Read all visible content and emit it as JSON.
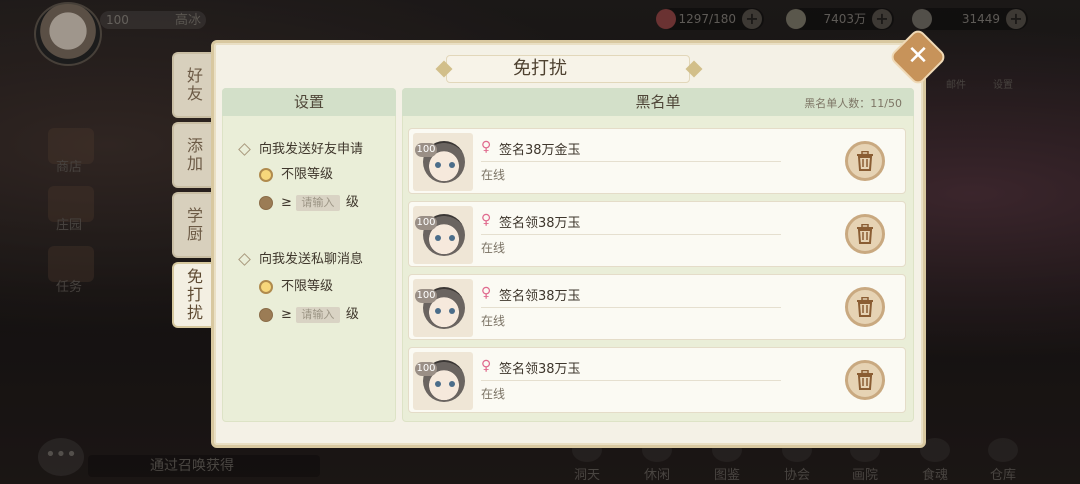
{
  "top": {
    "player_level": "100",
    "player_name": "高冰",
    "resources": [
      {
        "icon": "gem-icon",
        "value": "1297/180"
      },
      {
        "icon": "feather-icon",
        "value": "7403万"
      },
      {
        "icon": "coin-icon",
        "value": "31449"
      }
    ],
    "right_buttons": [
      "邮件",
      "设置"
    ]
  },
  "left_side": [
    "商店",
    "庄园",
    "任务"
  ],
  "bottom_nav": [
    "洞天",
    "休闲",
    "图鉴",
    "协会",
    "画院",
    "食魂",
    "仓库"
  ],
  "chat_text": "通过召唤获得",
  "tabs": [
    {
      "label": "好友",
      "active": false
    },
    {
      "label": "添加",
      "active": false
    },
    {
      "label": "学厨",
      "active": false
    },
    {
      "label": "免打扰",
      "active": true
    }
  ],
  "dialog": {
    "title": "免打扰",
    "close_label": "✕"
  },
  "settings": {
    "header": "设置",
    "sections": [
      {
        "label": "向我发送好友申请",
        "opt_any": "不限等级",
        "ge": "≥",
        "placeholder": "请输入",
        "unit": "级",
        "selected": "any"
      },
      {
        "label": "向我发送私聊消息",
        "opt_any": "不限等级",
        "ge": "≥",
        "placeholder": "请输入",
        "unit": "级",
        "selected": "any"
      }
    ]
  },
  "blacklist": {
    "header": "黑名单",
    "count_label": "黑名单人数：",
    "count": "11/50",
    "entries": [
      {
        "level": "100",
        "gender": "♀",
        "name": "签名38万金玉",
        "status": "在线"
      },
      {
        "level": "100",
        "gender": "♀",
        "name": "签名领38万玉",
        "status": "在线"
      },
      {
        "level": "100",
        "gender": "♀",
        "name": "签名领38万玉",
        "status": "在线"
      },
      {
        "level": "100",
        "gender": "♀",
        "name": "签名领38万玉",
        "status": "在线"
      }
    ]
  }
}
